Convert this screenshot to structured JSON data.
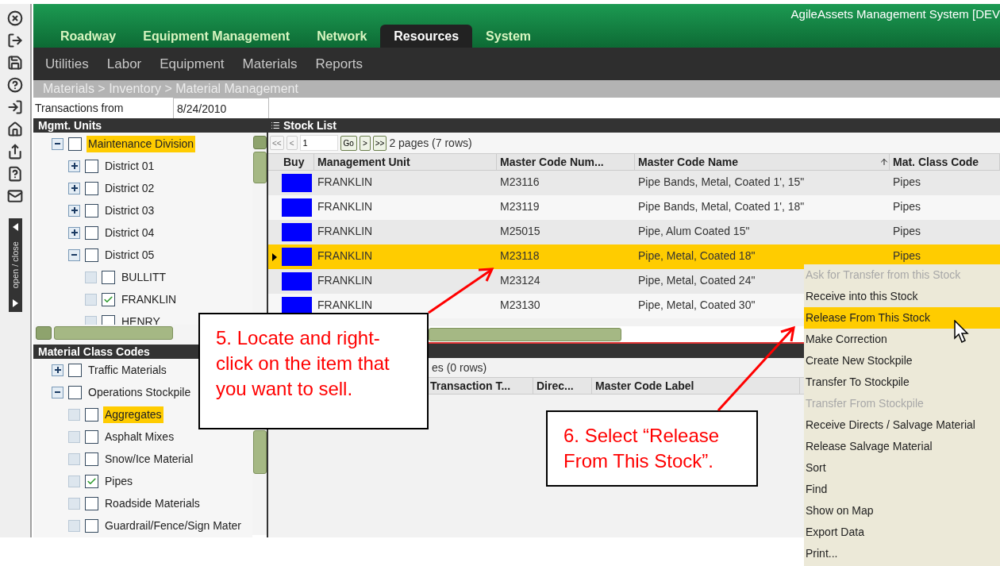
{
  "app_title": "AgileAssets Management System [DEV",
  "main_tabs": [
    {
      "label": "Roadway",
      "selected": false
    },
    {
      "label": "Equipment Management",
      "selected": false
    },
    {
      "label": "Network",
      "selected": false
    },
    {
      "label": "Resources",
      "selected": true
    },
    {
      "label": "System",
      "selected": false
    }
  ],
  "sub_nav": [
    "Utilities",
    "Labor",
    "Equipment",
    "Materials",
    "Reports"
  ],
  "breadcrumb": "Materials > Inventory > Material Management",
  "side_toggle": "open / close",
  "transactions": {
    "label": "Transactions from",
    "value": "8/24/2010"
  },
  "mgmt_units": {
    "title": "Mgmt. Units",
    "tree": [
      {
        "label": "Maintenance Division",
        "kind": "node",
        "expanded": true,
        "checked": false,
        "selected": true,
        "children": [
          {
            "label": "District 01",
            "kind": "node",
            "expanded": false,
            "checked": false,
            "selected": false
          },
          {
            "label": "District 02",
            "kind": "node",
            "expanded": false,
            "checked": false,
            "selected": false
          },
          {
            "label": "District 03",
            "kind": "node",
            "expanded": false,
            "checked": false,
            "selected": false
          },
          {
            "label": "District 04",
            "kind": "node",
            "expanded": false,
            "checked": false,
            "selected": false
          },
          {
            "label": "District 05",
            "kind": "node",
            "expanded": true,
            "checked": false,
            "selected": false,
            "children": [
              {
                "label": "BULLITT",
                "kind": "leaf",
                "checked": false,
                "selected": false
              },
              {
                "label": "FRANKLIN",
                "kind": "leaf",
                "checked": true,
                "selected": false
              },
              {
                "label": "HENRY",
                "kind": "leaf",
                "checked": false,
                "selected": false
              }
            ]
          }
        ]
      }
    ]
  },
  "material_class_codes": {
    "title": "Material Class Codes",
    "tree": [
      {
        "label": "Traffic Materials",
        "kind": "node",
        "expanded": false,
        "checked": false,
        "selected": false
      },
      {
        "label": "Operations Stockpile",
        "kind": "node",
        "expanded": true,
        "checked": false,
        "selected": false,
        "children": [
          {
            "label": "Aggregates",
            "kind": "leaf",
            "checked": false,
            "selected": true
          },
          {
            "label": "Asphalt Mixes",
            "kind": "leaf",
            "checked": false,
            "selected": false
          },
          {
            "label": "Snow/Ice Material",
            "kind": "leaf",
            "checked": false,
            "selected": false
          },
          {
            "label": "Pipes",
            "kind": "leaf",
            "checked": true,
            "selected": false
          },
          {
            "label": "Roadside Materials",
            "kind": "leaf",
            "checked": false,
            "selected": false
          },
          {
            "label": "Guardrail/Fence/Sign Mater",
            "kind": "leaf",
            "checked": false,
            "selected": false
          }
        ]
      }
    ]
  },
  "stock_list": {
    "title": "Stock List",
    "pager": {
      "first": "<<",
      "prev": "<",
      "page": "1",
      "go": "Go",
      "next": ">",
      "last": ">>",
      "summary": "2 pages (7 rows)"
    },
    "columns": [
      "Buy",
      "Management Unit",
      "Master Code Num...",
      "Master Code Name",
      "Mat. Class Code"
    ],
    "rows": [
      {
        "unit": "FRANKLIN",
        "code": "M23116",
        "name": "Pipe Bands, Metal, Coated 1', 15\"",
        "class": "Pipes",
        "selected": false
      },
      {
        "unit": "FRANKLIN",
        "code": "M23119",
        "name": "Pipe Bands, Metal, Coated 1', 18\"",
        "class": "Pipes",
        "selected": false
      },
      {
        "unit": "FRANKLIN",
        "code": "M25015",
        "name": "Pipe, Alum Coated 15\"",
        "class": "Pipes",
        "selected": false
      },
      {
        "unit": "FRANKLIN",
        "code": "M23118",
        "name": "Pipe, Metal, Coated 18\"",
        "class": "Pipes",
        "selected": true
      },
      {
        "unit": "FRANKLIN",
        "code": "M23124",
        "name": "Pipe, Metal, Coated 24\"",
        "selected": false
      },
      {
        "unit": "FRANKLIN",
        "code": "M23130",
        "name": "Pipe, Metal, Coated 30\"",
        "selected": false
      }
    ]
  },
  "transactions_list": {
    "summary": "es (0 rows)",
    "columns": [
      "Transaction T...",
      "Direc...",
      "Master Code Label"
    ]
  },
  "context_menu": [
    {
      "label": "Ask for Transfer from this Stock",
      "disabled": true,
      "selected": false
    },
    {
      "label": "Receive into this Stock",
      "disabled": false,
      "selected": false
    },
    {
      "label": "Release From This Stock",
      "disabled": false,
      "selected": true
    },
    {
      "label": "Make Correction",
      "disabled": false,
      "selected": false
    },
    {
      "label": "Create New Stockpile",
      "disabled": false,
      "selected": false
    },
    {
      "label": "Transfer To Stockpile",
      "disabled": false,
      "selected": false
    },
    {
      "label": "Transfer From Stockpile",
      "disabled": true,
      "selected": false
    },
    {
      "label": "Receive Directs / Salvage Material",
      "disabled": false,
      "selected": false
    },
    {
      "label": "Release Salvage Material",
      "disabled": false,
      "selected": false
    },
    {
      "label": "Sort",
      "disabled": false,
      "selected": false
    },
    {
      "label": "Find",
      "disabled": false,
      "selected": false
    },
    {
      "label": "Show on Map",
      "disabled": false,
      "selected": false
    },
    {
      "label": "Export Data",
      "disabled": false,
      "selected": false
    },
    {
      "label": "Print...",
      "disabled": false,
      "selected": false
    }
  ],
  "callouts": [
    "5. Locate and right-click on the item that you want to sell.",
    "6. Select “Release From This Stock”."
  ]
}
